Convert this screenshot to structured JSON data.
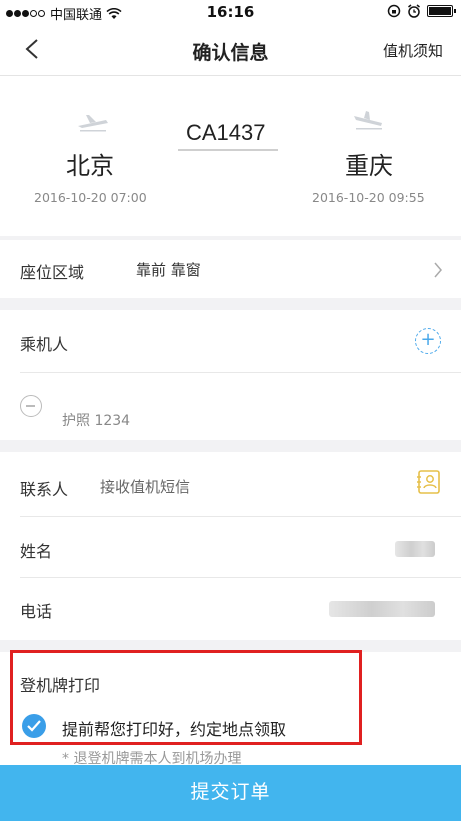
{
  "status_bar": {
    "carrier": "中国联通",
    "time": "16:16"
  },
  "nav": {
    "title": "确认信息",
    "right_link": "值机须知"
  },
  "flight": {
    "from_city": "北京",
    "to_city": "重庆",
    "flight_no": "CA1437",
    "depart_time": "2016-10-20 07:00",
    "arrive_time": "2016-10-20 09:55"
  },
  "seat": {
    "label": "座位区域",
    "value": "靠前 靠窗"
  },
  "passenger": {
    "label": "乘机人",
    "id_text": "护照 1234"
  },
  "contact": {
    "label": "联系人",
    "hint": "接收值机短信",
    "name_label": "姓名",
    "phone_label": "电话"
  },
  "boarding": {
    "title": "登机牌打印",
    "option": "提前帮您打印好，约定地点领取",
    "note": "* 退登机牌需本人到机场办理"
  },
  "submit_label": "提交订单",
  "colors": {
    "accent": "#42b5ee",
    "highlight_border": "#e02020"
  }
}
